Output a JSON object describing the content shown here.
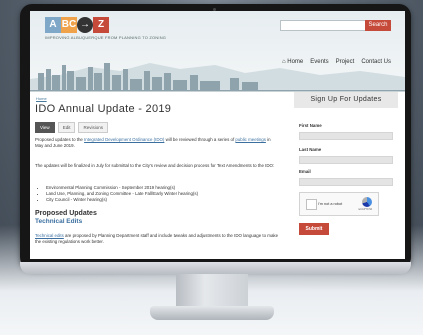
{
  "header": {
    "logo_letters": [
      "A",
      "BC",
      "→",
      "Z"
    ],
    "logo_colors": [
      "#7fa8c8",
      "#f0a24a",
      "#333333",
      "#c64a3a"
    ],
    "tagline": "IMPROVING ALBUQUERQUE FROM PLANNING TO ZONING",
    "search_button": "Search",
    "nav": [
      "Home",
      "Events",
      "Project",
      "Contact Us"
    ]
  },
  "main": {
    "breadcrumb": "Home",
    "title": "IDO Annual Update - 2019",
    "tabs": [
      "View",
      "Edit",
      "Revisions"
    ],
    "para1_a": "Proposed updates to the ",
    "para1_link1": "Integrated Development Ordinance (IDO)",
    "para1_b": " will be reviewed through a series of ",
    "para1_link2": "public meetings",
    "para1_c": " in May and June 2019.",
    "para2": "The updates will be finalized in July for submittal to the City's review and decision process for Text Amendments to the IDO:",
    "bullets": [
      "Environmental Planning Commission - September 2019 hearing(s)",
      "Land Use, Planning, and Zoning Committee - Late Fall/Early Winter hearing(s)",
      "City Council - Winter hearing(s)"
    ],
    "section_heading": "Proposed Updates",
    "sub_heading": "Technical Edits",
    "para3_link": "Technical edits",
    "para3": " are proposed by Planning Department staff and include tweaks and adjustments to the IDO language to make the existing regulations work better."
  },
  "sidebar": {
    "heading": "Sign Up For Updates",
    "first_name": "First Name",
    "last_name": "Last Name",
    "email": "Email",
    "captcha_text": "I'm not a robot",
    "captcha_small": "reCAPTCHA",
    "submit": "Submit"
  }
}
